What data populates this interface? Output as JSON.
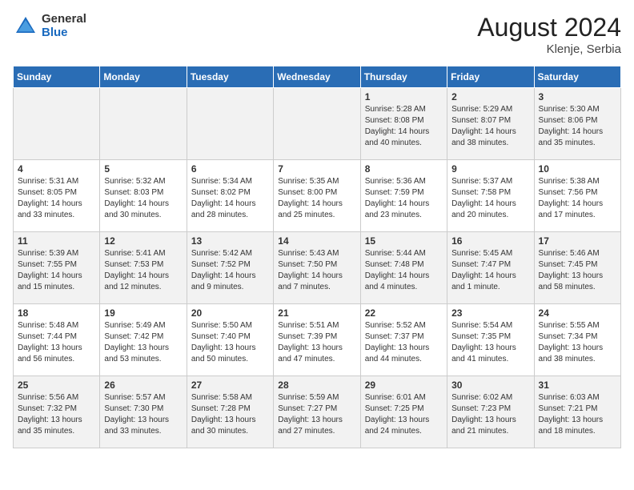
{
  "header": {
    "title": "August 2024",
    "location": "Klenje, Serbia",
    "logo_general": "General",
    "logo_blue": "Blue"
  },
  "days_of_week": [
    "Sunday",
    "Monday",
    "Tuesday",
    "Wednesday",
    "Thursday",
    "Friday",
    "Saturday"
  ],
  "weeks": [
    [
      {
        "day": "",
        "content": ""
      },
      {
        "day": "",
        "content": ""
      },
      {
        "day": "",
        "content": ""
      },
      {
        "day": "",
        "content": ""
      },
      {
        "day": "1",
        "content": "Sunrise: 5:28 AM\nSunset: 8:08 PM\nDaylight: 14 hours\nand 40 minutes."
      },
      {
        "day": "2",
        "content": "Sunrise: 5:29 AM\nSunset: 8:07 PM\nDaylight: 14 hours\nand 38 minutes."
      },
      {
        "day": "3",
        "content": "Sunrise: 5:30 AM\nSunset: 8:06 PM\nDaylight: 14 hours\nand 35 minutes."
      }
    ],
    [
      {
        "day": "4",
        "content": "Sunrise: 5:31 AM\nSunset: 8:05 PM\nDaylight: 14 hours\nand 33 minutes."
      },
      {
        "day": "5",
        "content": "Sunrise: 5:32 AM\nSunset: 8:03 PM\nDaylight: 14 hours\nand 30 minutes."
      },
      {
        "day": "6",
        "content": "Sunrise: 5:34 AM\nSunset: 8:02 PM\nDaylight: 14 hours\nand 28 minutes."
      },
      {
        "day": "7",
        "content": "Sunrise: 5:35 AM\nSunset: 8:00 PM\nDaylight: 14 hours\nand 25 minutes."
      },
      {
        "day": "8",
        "content": "Sunrise: 5:36 AM\nSunset: 7:59 PM\nDaylight: 14 hours\nand 23 minutes."
      },
      {
        "day": "9",
        "content": "Sunrise: 5:37 AM\nSunset: 7:58 PM\nDaylight: 14 hours\nand 20 minutes."
      },
      {
        "day": "10",
        "content": "Sunrise: 5:38 AM\nSunset: 7:56 PM\nDaylight: 14 hours\nand 17 minutes."
      }
    ],
    [
      {
        "day": "11",
        "content": "Sunrise: 5:39 AM\nSunset: 7:55 PM\nDaylight: 14 hours\nand 15 minutes."
      },
      {
        "day": "12",
        "content": "Sunrise: 5:41 AM\nSunset: 7:53 PM\nDaylight: 14 hours\nand 12 minutes."
      },
      {
        "day": "13",
        "content": "Sunrise: 5:42 AM\nSunset: 7:52 PM\nDaylight: 14 hours\nand 9 minutes."
      },
      {
        "day": "14",
        "content": "Sunrise: 5:43 AM\nSunset: 7:50 PM\nDaylight: 14 hours\nand 7 minutes."
      },
      {
        "day": "15",
        "content": "Sunrise: 5:44 AM\nSunset: 7:48 PM\nDaylight: 14 hours\nand 4 minutes."
      },
      {
        "day": "16",
        "content": "Sunrise: 5:45 AM\nSunset: 7:47 PM\nDaylight: 14 hours\nand 1 minute."
      },
      {
        "day": "17",
        "content": "Sunrise: 5:46 AM\nSunset: 7:45 PM\nDaylight: 13 hours\nand 58 minutes."
      }
    ],
    [
      {
        "day": "18",
        "content": "Sunrise: 5:48 AM\nSunset: 7:44 PM\nDaylight: 13 hours\nand 56 minutes."
      },
      {
        "day": "19",
        "content": "Sunrise: 5:49 AM\nSunset: 7:42 PM\nDaylight: 13 hours\nand 53 minutes."
      },
      {
        "day": "20",
        "content": "Sunrise: 5:50 AM\nSunset: 7:40 PM\nDaylight: 13 hours\nand 50 minutes."
      },
      {
        "day": "21",
        "content": "Sunrise: 5:51 AM\nSunset: 7:39 PM\nDaylight: 13 hours\nand 47 minutes."
      },
      {
        "day": "22",
        "content": "Sunrise: 5:52 AM\nSunset: 7:37 PM\nDaylight: 13 hours\nand 44 minutes."
      },
      {
        "day": "23",
        "content": "Sunrise: 5:54 AM\nSunset: 7:35 PM\nDaylight: 13 hours\nand 41 minutes."
      },
      {
        "day": "24",
        "content": "Sunrise: 5:55 AM\nSunset: 7:34 PM\nDaylight: 13 hours\nand 38 minutes."
      }
    ],
    [
      {
        "day": "25",
        "content": "Sunrise: 5:56 AM\nSunset: 7:32 PM\nDaylight: 13 hours\nand 35 minutes."
      },
      {
        "day": "26",
        "content": "Sunrise: 5:57 AM\nSunset: 7:30 PM\nDaylight: 13 hours\nand 33 minutes."
      },
      {
        "day": "27",
        "content": "Sunrise: 5:58 AM\nSunset: 7:28 PM\nDaylight: 13 hours\nand 30 minutes."
      },
      {
        "day": "28",
        "content": "Sunrise: 5:59 AM\nSunset: 7:27 PM\nDaylight: 13 hours\nand 27 minutes."
      },
      {
        "day": "29",
        "content": "Sunrise: 6:01 AM\nSunset: 7:25 PM\nDaylight: 13 hours\nand 24 minutes."
      },
      {
        "day": "30",
        "content": "Sunrise: 6:02 AM\nSunset: 7:23 PM\nDaylight: 13 hours\nand 21 minutes."
      },
      {
        "day": "31",
        "content": "Sunrise: 6:03 AM\nSunset: 7:21 PM\nDaylight: 13 hours\nand 18 minutes."
      }
    ]
  ]
}
